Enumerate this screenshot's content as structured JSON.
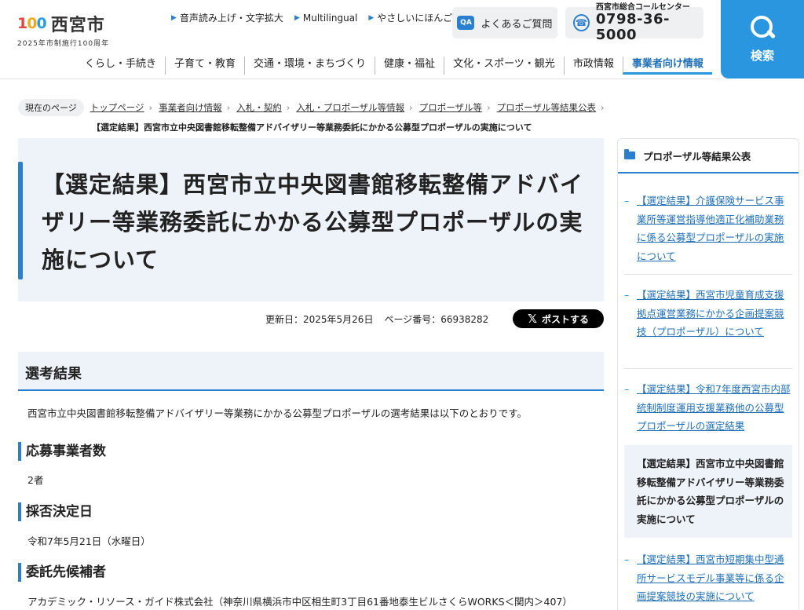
{
  "header": {
    "logo_mark": "100",
    "logo_text": "西宮市",
    "logo_sub": "2025年市制施行100周年",
    "top_links": [
      "音声読み上げ・文字拡大",
      "Multilingual",
      "やさしいにほんご"
    ],
    "faq_label": "よくあるご質問",
    "faq_icon_text": "QA",
    "call_label": "西宮市総合コールセンター",
    "call_number": "0798-36-5000",
    "search_label": "検索"
  },
  "nav": {
    "items": [
      "くらし・手続き",
      "子育て・教育",
      "交通・環境・まちづくり",
      "健康・福祉",
      "文化・スポーツ・観光",
      "市政情報",
      "事業者向け情報"
    ]
  },
  "breadcrumb": {
    "here_label": "現在のページ",
    "items": [
      "トップページ",
      "事業者向け情報",
      "入札・契約",
      "入札・プロポーザル等情報",
      "プロポーザル等",
      "プロポーザル等結果公表"
    ],
    "current": "【選定結果】西宮市立中央図書館移転整備アドバイザリー等業務委託にかかる公募型プロポーザルの実施について"
  },
  "page": {
    "title": "【選定結果】西宮市立中央図書館移転整備アドバイザリー等業務委託にかかる公募型プロポーザルの実施について",
    "updated": "更新日：2025年5月26日",
    "page_number": "ページ番号：66938282",
    "post_label": "ポストする",
    "section_title": "選考結果",
    "intro": "西宮市立中央図書館移転整備アドバイザリー等業務にかかる公募型プロポーザルの選考結果は以下のとおりです。",
    "h_applicants": "応募事業者数",
    "applicants": "2者",
    "h_decision": "採否決定日",
    "decision_date": "令和7年5月21日（水曜日）",
    "h_candidate": "委託先候補者",
    "candidate": "アカデミック・リソース・ガイド株式会社（神奈川県横浜市中区相生町3丁目61番地泰生ビルさくらWORKS＜関内＞407）"
  },
  "side": {
    "heading": "プロポーザル等結果公表",
    "items": [
      "【選定結果】介護保険サービス事業所等運営指導他適正化補助業務に係る公募型プロポーザルの実施について",
      "【選定結果】西宮市児童育成支援拠点運営業務にかかる企画提案競技（プロポーザル）について",
      "【選定結果】令和7年度西宮市内部統制制度運用支援業務他の公募型プロポーザルの選定結果",
      "【選定結果】西宮市立中央図書館移転整備アドバイザリー等業務委託にかかる公募型プロポーザルの実施について",
      "【選定結果】西宮市短期集中型通所サービスモデル事業等に係る企画提案競技の実施について"
    ]
  },
  "colors": {
    "accent": "#2a7fd1",
    "search_bg": "#2a96e0",
    "panel_bg": "#eef3f9"
  }
}
